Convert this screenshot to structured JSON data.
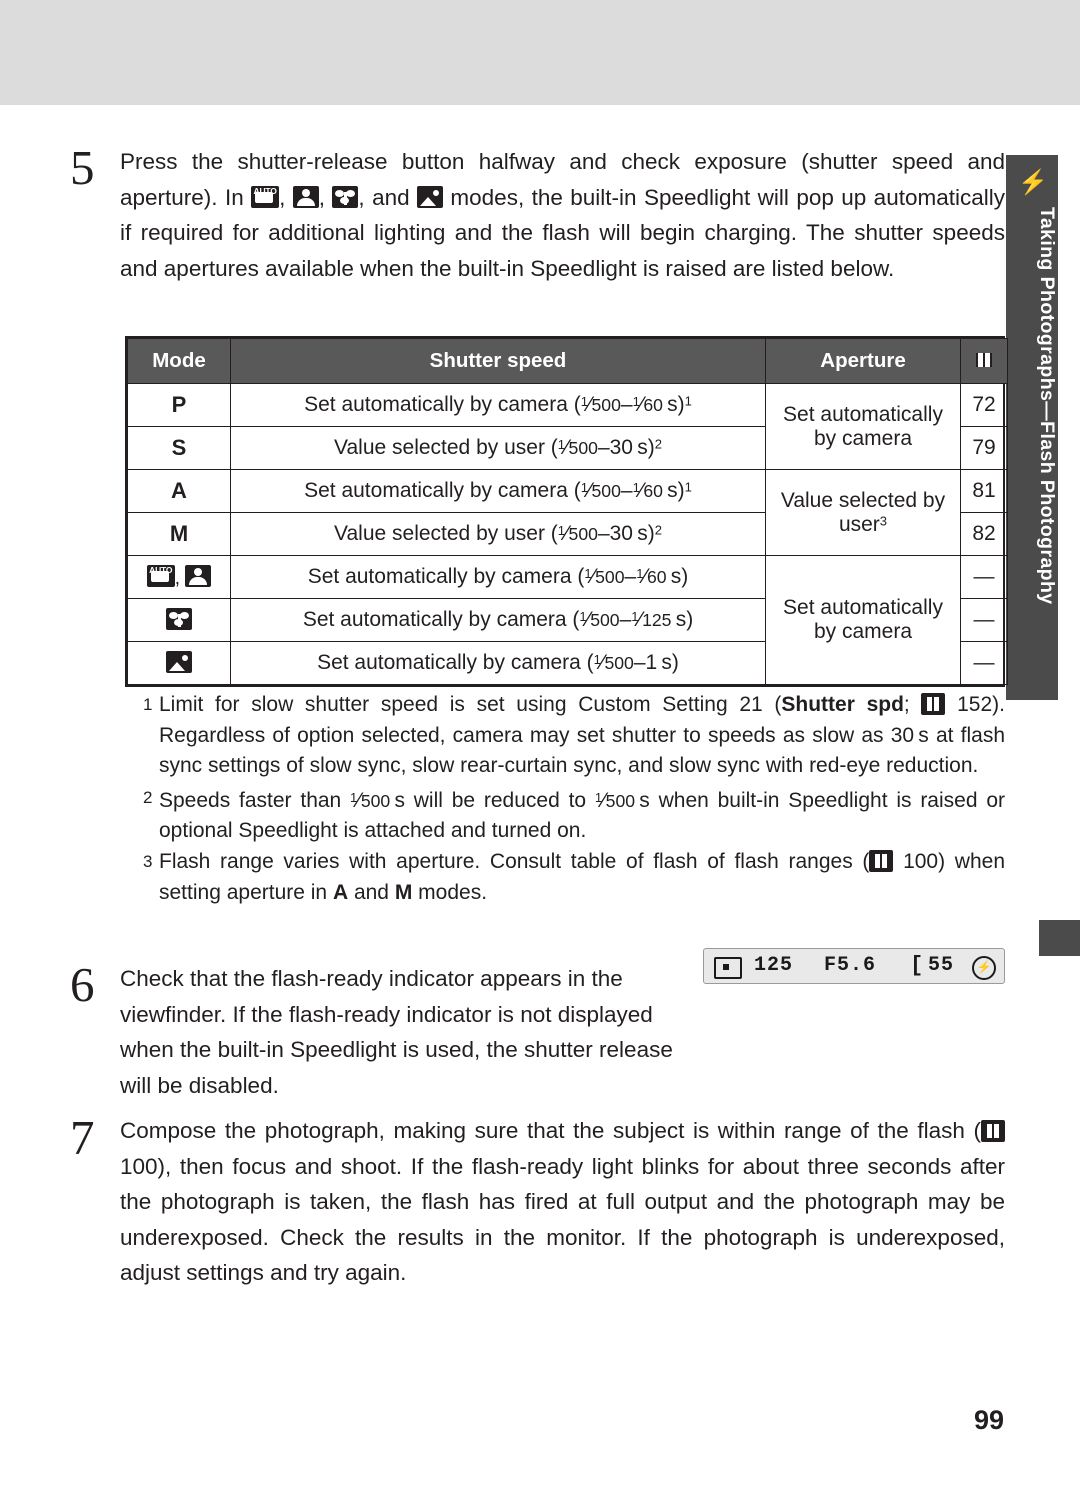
{
  "page": {
    "number": "99",
    "side_tab": {
      "icon": "flash-icon",
      "label": "Taking Photographs—Flash Photography"
    }
  },
  "steps": [
    {
      "number": "5",
      "text_parts": {
        "p1": "Press the shutter-release button halfway and check exposure (shutter speed and aperture).  In ",
        "p2": ", ",
        "p3": ", ",
        "p4": ", and ",
        "p5": " modes, the built-in Speedlight will pop up automatically if required for additional lighting and the flash will begin charging.  The shutter speeds and apertures available when the built-in Speedlight is raised are listed below."
      },
      "icons": [
        "auto-mode-icon",
        "portrait-mode-icon",
        "macro-mode-icon",
        "night-portrait-mode-icon"
      ]
    },
    {
      "number": "6",
      "text": "Check that the flash-ready indicator appears in the viewfinder.  If the flash-ready indicator is not displayed when the built-in Speedlight is used, the shutter release will be disabled."
    },
    {
      "number": "7",
      "text_parts": {
        "p1": "Compose the photograph, making sure that the subject is within range of the flash (",
        "p2": " 100), then focus and shoot.  If the flash-ready light blinks for about three seconds after the photograph is taken, the flash has fired at full output and the photograph may be underexposed.  Check the results in the monitor.  If the photograph is underexposed, adjust settings and try again."
      }
    }
  ],
  "table": {
    "headers": {
      "mode": "Mode",
      "shutter_speed": "Shutter speed",
      "aperture": "Aperture",
      "page": "book-icon"
    },
    "rows": [
      {
        "mode": "P",
        "mode_type": "text",
        "shutter": "Set automatically by camera (1/500–1/60 s)1",
        "shutter_html": "Set automatically by camera (<span class=\"frac\"><sup>1</sup>⁄<sub>500</sub></span>–<span class=\"frac\"><sup>1</sup>⁄<sub>60</sub></span> s)<span class=\"sup\">1</span>",
        "page": "72"
      },
      {
        "mode": "S",
        "mode_type": "text",
        "shutter": "Value selected by user (1/500–30 s)2",
        "page": "79"
      },
      {
        "mode": "A",
        "mode_type": "text",
        "shutter": "Set automatically by camera (1/500–1/60 s)1",
        "page": "81"
      },
      {
        "mode": "M",
        "mode_type": "text",
        "shutter": "Value selected by user (1/500–30 s)2",
        "page": "82"
      },
      {
        "mode": "auto-and-portrait-icons",
        "mode_type": "icons",
        "shutter": "Set automatically by camera (1/500–1/60 s)",
        "page": "—"
      },
      {
        "mode": "macro-icon",
        "mode_type": "icons",
        "shutter": "Set automatically by camera (1/500–1/125 s)",
        "page": "—"
      },
      {
        "mode": "night-portrait-icon",
        "mode_type": "icons",
        "shutter": "Set automatically by camera (1/500–1 s)",
        "page": "—"
      }
    ],
    "aperture_cells": [
      {
        "text": "Set automatically by camera",
        "rows": 2
      },
      {
        "text": "Value selected by user3",
        "rows": 2
      },
      {
        "text": "Set automatically by camera",
        "rows": 3
      }
    ]
  },
  "footnotes": [
    {
      "number": "1",
      "text": "Limit for slow shutter speed is set using Custom Setting 21 (Shutter spd;  152).  Regardless of option selected, camera may set shutter to speeds as slow as 30 s at flash sync settings of slow sync, slow rear-curtain sync, and slow sync with red-eye reduction.",
      "bold_segment": "Shutter spd",
      "page_ref": "152"
    },
    {
      "number": "2",
      "text": "Speeds faster than 1/500 s will be reduced to 1/500 s when built-in Speedlight is raised or optional Speedlight is attached and turned on."
    },
    {
      "number": "3",
      "text": "Flash range varies with aperture.  Consult table of flash of flash ranges ( 100) when setting aperture in A and M modes.",
      "page_ref": "100",
      "bold_segments": [
        "A",
        "M"
      ]
    }
  ],
  "viewfinder": {
    "focus_indicator": "focus-box-icon",
    "shutter_speed": "125",
    "aperture": "F5.6",
    "bracket": "[",
    "frame_count": "55",
    "flash_ready": "flash-ready-icon"
  }
}
